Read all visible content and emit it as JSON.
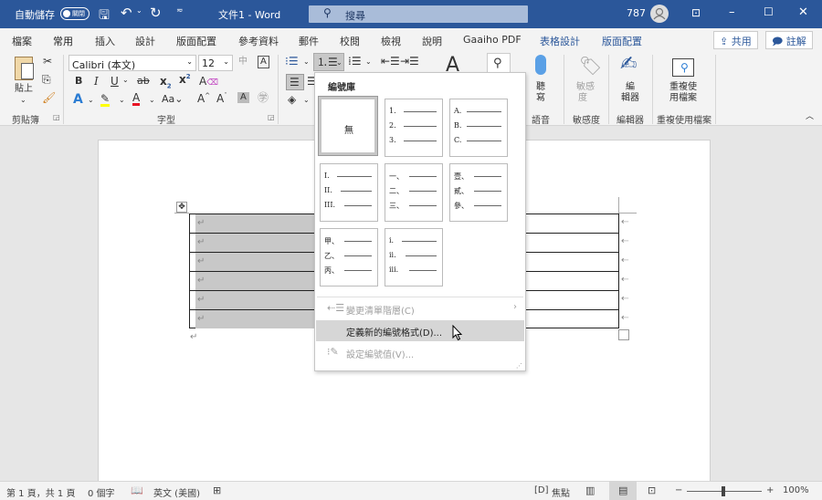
{
  "titlebar": {
    "autosave_label": "自動儲存",
    "autosave_state": "關閉",
    "doc_title": "文件1 - Word",
    "search_placeholder": "搜尋",
    "user_count": "787"
  },
  "tabs": [
    {
      "label": "檔案"
    },
    {
      "label": "常用"
    },
    {
      "label": "插入"
    },
    {
      "label": "設計"
    },
    {
      "label": "版面配置"
    },
    {
      "label": "參考資料"
    },
    {
      "label": "郵件"
    },
    {
      "label": "校閱"
    },
    {
      "label": "檢視"
    },
    {
      "label": "說明"
    },
    {
      "label": "Gaaiho PDF"
    },
    {
      "label": "表格設計"
    },
    {
      "label": "版面配置"
    }
  ],
  "tab_buttons": {
    "share": "共用",
    "comments": "註解"
  },
  "ribbon": {
    "clipboard": {
      "paste": "貼上",
      "group": "剪貼簿"
    },
    "font": {
      "name": "Calibri (本文)",
      "size": "12",
      "group": "字型"
    },
    "voice": {
      "dictate_1": "聽",
      "dictate_2": "寫",
      "group": "語音"
    },
    "sensitivity": {
      "label_1": "敏感",
      "label_2": "度",
      "group": "敏感度"
    },
    "editor": {
      "label_1": "編",
      "label_2": "輯器",
      "group": "編輯器"
    },
    "reuse": {
      "label_1": "重複使",
      "label_2": "用檔案",
      "group": "重複使用檔案"
    }
  },
  "dropdown": {
    "title": "編號庫",
    "none_label": "無",
    "libraries": [
      [
        "1.",
        "2.",
        "3."
      ],
      [
        "A.",
        "B.",
        "C."
      ],
      [
        "I.",
        "II.",
        "III."
      ],
      [
        "一、",
        "二、",
        "三、"
      ],
      [
        "壹、",
        "貳、",
        "參、"
      ],
      [
        "甲、",
        "乙、",
        "丙、"
      ],
      [
        "i.",
        "ii.",
        "iii."
      ]
    ],
    "menu": {
      "change_level": "變更清單階層(C)",
      "define_new": "定義新的編號格式(D)...",
      "set_value": "設定編號值(V)..."
    }
  },
  "statusbar": {
    "page": "第 1 頁，共 1 頁",
    "words": "0 個字",
    "language": "英文 (美國)",
    "focus": "焦點",
    "zoom": "100%"
  },
  "colors": {
    "accent": "#2b579a",
    "highlight": "#ffff00",
    "font_color": "#e81123"
  }
}
